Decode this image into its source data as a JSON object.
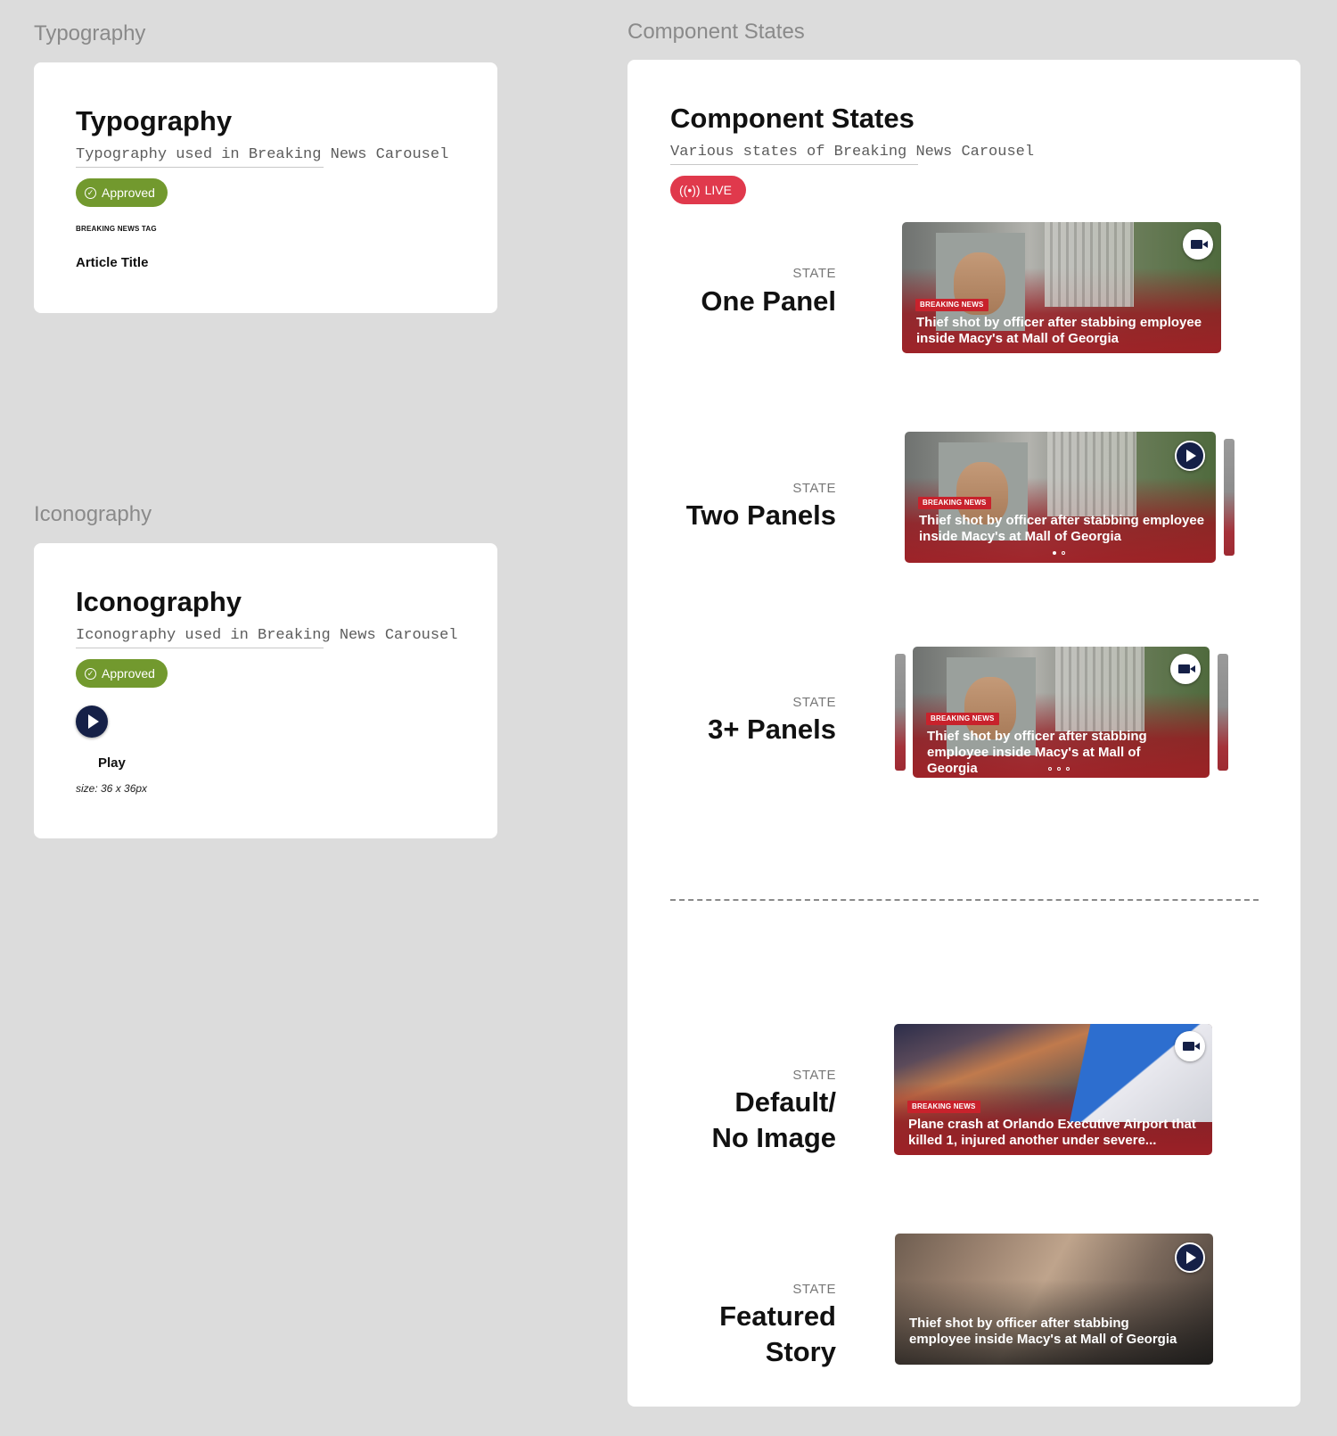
{
  "typography": {
    "section_label": "Typography",
    "title": "Typography",
    "subtitle": "Typography used in Breaking News Carousel",
    "status": "Approved",
    "tag_sample": "BREAKING NEWS TAG",
    "title_sample": "Article Title"
  },
  "iconography": {
    "section_label": "Iconography",
    "title": "Iconography",
    "subtitle": "Iconography used in Breaking News Carousel",
    "status": "Approved",
    "icon_name": "Play",
    "icon_size": "size: 36 x 36px",
    "icon": "play-icon"
  },
  "component_states": {
    "section_label": "Component States",
    "title": "Component States",
    "subtitle": "Various states of Breaking News Carousel",
    "live_label": "LIVE",
    "state_caption": "STATE",
    "states": [
      {
        "name": "One Panel",
        "tag": "BREAKING NEWS",
        "headline": "Thief shot by officer after stabbing employee inside Macy's at Mall of Georgia",
        "media_icon": "video-camera-icon"
      },
      {
        "name": "Two Panels",
        "tag": "BREAKING NEWS",
        "headline": "Thief shot by officer after stabbing employee inside Macy's at Mall of Georgia",
        "media_icon": "play-icon"
      },
      {
        "name": "3+ Panels",
        "tag": "BREAKING NEWS",
        "headline": "Thief shot by officer after stabbing employee inside Macy's at Mall of Georgia",
        "media_icon": "video-camera-icon"
      },
      {
        "name_line1": "Default/",
        "name_line2": "No Image",
        "tag": "BREAKING NEWS",
        "headline": "Plane crash at Orlando Executive Airport that killed 1, injured another under severe...",
        "media_icon": "video-camera-icon"
      },
      {
        "name_line1": "Featured",
        "name_line2": "Story",
        "headline": "Thief shot by officer after stabbing employee inside Macy's at Mall of Georgia",
        "media_icon": "play-icon"
      }
    ]
  },
  "colors": {
    "approved": "#72992e",
    "live": "#e0394c",
    "breaking_tag": "#c8222c",
    "icon_navy": "#152047",
    "canvas": "#dcdcdc"
  }
}
